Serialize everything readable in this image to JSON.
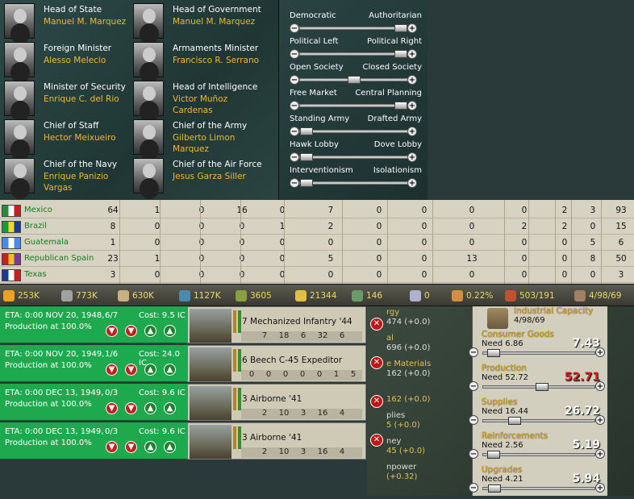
{
  "cabinet": [
    {
      "title": "Head of State",
      "name": "Manuel M. Marquez"
    },
    {
      "title": "Head of Government",
      "name": "Manuel M. Marquez"
    },
    {
      "title": "Foreign Minister",
      "name": "Alesso Melecio"
    },
    {
      "title": "Armaments Minister",
      "name": "Francisco R. Serrano"
    },
    {
      "title": "Minister of Security",
      "name": "Enrique C. del Rio"
    },
    {
      "title": "Head of Intelligence",
      "name": "Victor Muñoz Cardenas"
    },
    {
      "title": "Chief of Staff",
      "name": "Hector Meixueiro"
    },
    {
      "title": "Chief of the Army",
      "name": "Gilberto Limon Marquez"
    },
    {
      "title": "Chief of the Navy",
      "name": "Enrique Panizio Vargas"
    },
    {
      "title": "Chief of the Air Force",
      "name": "Jesus Garza Siller"
    }
  ],
  "policies": [
    {
      "left": "Democratic",
      "right": "Authoritarian",
      "level": 1.0
    },
    {
      "left": "Political Left",
      "right": "Political Right",
      "level": 1.0
    },
    {
      "left": "Open Society",
      "right": "Closed Society",
      "level": 0.5
    },
    {
      "left": "Free Market",
      "right": "Central Planning",
      "level": 1.0
    },
    {
      "left": "Standing Army",
      "right": "Drafted Army",
      "level": 0.0
    },
    {
      "left": "Hawk Lobby",
      "right": "Dove Lobby",
      "level": 0.0
    },
    {
      "left": "Interventionism",
      "right": "Isolationism",
      "level": 0.0
    }
  ],
  "relations": [
    {
      "country": "Mexico",
      "flag": [
        "#2a8a3a",
        "#ffffff",
        "#c82020"
      ],
      "values": [
        "64",
        "1",
        "0",
        "16",
        "0",
        "7",
        "0",
        "0",
        "0",
        "0",
        "2",
        "3",
        "93"
      ]
    },
    {
      "country": "Brazil",
      "flag": [
        "#1a9a3a",
        "#f8d820",
        "#1a3a9a"
      ],
      "values": [
        "8",
        "0",
        "0",
        "0",
        "1",
        "2",
        "0",
        "0",
        "0",
        "2",
        "2",
        "0",
        "15"
      ]
    },
    {
      "country": "Guatemala",
      "flag": [
        "#4a8ae8",
        "#ffffff",
        "#4a8ae8"
      ],
      "values": [
        "1",
        "0",
        "0",
        "0",
        "0",
        "0",
        "0",
        "0",
        "0",
        "0",
        "0",
        "5",
        "6"
      ]
    },
    {
      "country": "Republican Spain",
      "flag": [
        "#c82020",
        "#f0c020",
        "#7a3a9a"
      ],
      "values": [
        "23",
        "1",
        "0",
        "0",
        "0",
        "5",
        "0",
        "0",
        "13",
        "0",
        "0",
        "8",
        "50"
      ]
    },
    {
      "country": "Texas",
      "flag": [
        "#1a3a9a",
        "#ffffff",
        "#c82020"
      ],
      "values": [
        "3",
        "0",
        "0",
        "0",
        "0",
        "0",
        "0",
        "0",
        "0",
        "0",
        "0",
        "0",
        "3"
      ]
    }
  ],
  "resources": [
    {
      "icon": "energy-icon",
      "value": "253K",
      "color": "#f0a020"
    },
    {
      "icon": "metal-icon",
      "value": "773K",
      "color": "#a0a0a0"
    },
    {
      "icon": "rare-materials-icon",
      "value": "630K",
      "color": "#c8b080"
    },
    {
      "icon": "oil-icon",
      "value": "1127K",
      "color": "#4a8ab0"
    },
    {
      "icon": "supplies-icon",
      "value": "3605",
      "color": "#8aa040"
    },
    {
      "icon": "money-icon",
      "value": "21344",
      "color": "#e0c040"
    },
    {
      "icon": "manpower-icon",
      "value": "146",
      "color": "#6a9a6a"
    },
    {
      "icon": "espionage-icon",
      "value": "0",
      "color": "#b0b0d0"
    },
    {
      "icon": "dissent-icon",
      "value": "0.22%",
      "color": "#d09040"
    },
    {
      "icon": "transport-icon",
      "value": "503/191",
      "color": "#c05030"
    },
    {
      "icon": "ic-icon",
      "value": "4/98/69",
      "color": "#a08060"
    }
  ],
  "queue": [
    {
      "eta": "ETA: 0:00 NOV 20, 1948,",
      "production": "Production at 100.0%",
      "runs": "6/7",
      "cost": "Cost: 9.5 IC",
      "unit": "7 Mechanized Infantry '44",
      "stats": [
        "7",
        "18",
        "6",
        "32",
        "6"
      ]
    },
    {
      "eta": "ETA: 0:00 NOV 20, 1949,",
      "production": "Production at 100.0%",
      "runs": "1/6",
      "cost": "Cost: 24.0 IC",
      "unit": "6 Beech C-45 Expeditor",
      "stats": [
        "0",
        "0",
        "0",
        "0",
        "0",
        "1",
        "5"
      ]
    },
    {
      "eta": "ETA: 0:00 DEC 13, 1949,",
      "production": "Production at 100.0%",
      "runs": "0/3",
      "cost": "Cost: 9.6 IC",
      "unit": "3 Airborne '41",
      "stats": [
        "2",
        "10",
        "3",
        "16",
        "4"
      ]
    },
    {
      "eta": "ETA: 0:00 DEC 13, 1949,",
      "production": "Production at 100.0%",
      "runs": "0/3",
      "cost": "Cost: 9.6 IC",
      "unit": "3 Airborne '41",
      "stats": [
        "2",
        "10",
        "3",
        "16",
        "4"
      ]
    }
  ],
  "left_fragments": [
    "rgy",
    "474 (+0.0)",
    "al",
    "696 (+0.0)",
    "e Materials",
    "162 (+0.0)",
    "162 (+0.0)",
    "plies",
    "5 (+0.0)",
    "ney",
    "45 (+0.0)",
    "npower",
    "(+0.32)"
  ],
  "industry": {
    "title": "Industrial Capacity",
    "subtitle": "4/98/69",
    "sections": [
      {
        "title": "Consumer Goods",
        "need": "Need 6.86",
        "value": "7.43",
        "level": 0.04,
        "red": false
      },
      {
        "title": "Production",
        "need": "Need 52.72",
        "value": "52.71",
        "level": 0.53,
        "red": true
      },
      {
        "title": "Supplies",
        "need": "Need 16.44",
        "value": "26.72",
        "level": 0.25,
        "red": false
      },
      {
        "title": "Reinforcements",
        "need": "Need 2.56",
        "value": "5.19",
        "level": 0.04,
        "red": false
      },
      {
        "title": "Upgrades",
        "need": "Need 4.21",
        "value": "5.94",
        "level": 0.05,
        "red": false
      }
    ]
  }
}
